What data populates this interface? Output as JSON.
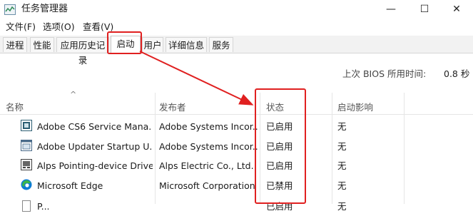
{
  "window": {
    "title": "任务管理器",
    "minimize_glyph": "—",
    "maximize_glyph": "☐",
    "close_glyph": "✕"
  },
  "menu": [
    "文件(F)",
    "选项(O)",
    "查看(V)"
  ],
  "tabs": [
    {
      "label": "进程",
      "active": false
    },
    {
      "label": "性能",
      "active": false
    },
    {
      "label": "应用历史记录",
      "active": false
    },
    {
      "label": "启动",
      "active": true
    },
    {
      "label": "用户",
      "active": false
    },
    {
      "label": "详细信息",
      "active": false
    },
    {
      "label": "服务",
      "active": false
    }
  ],
  "bios": {
    "label": "上次 BIOS 所用时间:",
    "value": "0.8 秒"
  },
  "columns": {
    "name": "名称",
    "publisher": "发布者",
    "status": "状态",
    "impact": "启动影响",
    "sort_caret": "^"
  },
  "rows": [
    {
      "name": "Adobe CS6 Service Mana...",
      "publisher": "Adobe Systems Incor...",
      "status": "已启用",
      "impact": "无",
      "icon": "adobe-cs6-icon"
    },
    {
      "name": "Adobe Updater Startup U...",
      "publisher": "Adobe Systems Incor...",
      "status": "已启用",
      "impact": "无",
      "icon": "adobe-updater-icon"
    },
    {
      "name": "Alps Pointing-device Driver",
      "publisher": "Alps Electric Co., Ltd.",
      "status": "已启用",
      "impact": "无",
      "icon": "alps-driver-icon"
    },
    {
      "name": "Microsoft Edge",
      "publisher": "Microsoft Corporation",
      "status": "已禁用",
      "impact": "无",
      "icon": "edge-icon"
    },
    {
      "name": "P...",
      "publisher": "",
      "status": "已启用",
      "impact": "无",
      "icon": "file-icon"
    }
  ],
  "colors": {
    "annotation": "#e02020",
    "edge_blue": "#0c7bd6",
    "edge_green": "#3bb54a"
  }
}
